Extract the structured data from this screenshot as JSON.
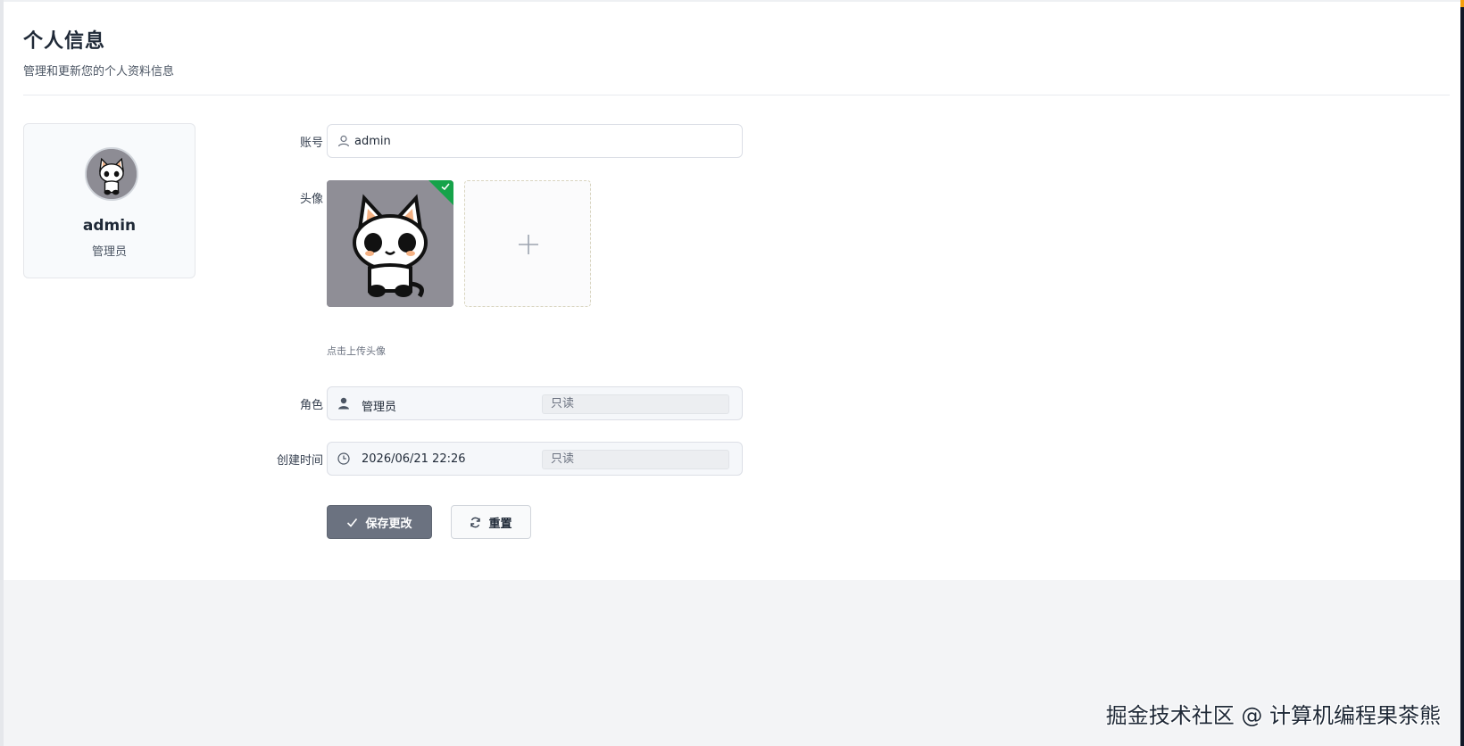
{
  "header": {
    "title": "个人信息",
    "subtitle": "管理和更新您的个人资料信息"
  },
  "profile": {
    "name": "admin",
    "role": "管理员"
  },
  "form": {
    "account": {
      "label": "账号",
      "value": "admin",
      "icon": "user-outline-icon"
    },
    "avatar": {
      "label": "头像",
      "upload_hint": "点击上传头像",
      "status": "uploaded"
    },
    "role": {
      "label": "角色",
      "value": "管理员",
      "readonly_tag": "只读",
      "icon": "user-solid-icon"
    },
    "created": {
      "label": "创建时间",
      "value": "2026/06/21 22:26",
      "readonly_tag": "只读",
      "icon": "clock-icon"
    }
  },
  "actions": {
    "save_label": "保存更改",
    "reset_label": "重置"
  },
  "watermark": "掘金技术社区 @ 计算机编程果茶熊",
  "colors": {
    "primary_button": "#6b7280",
    "success_badge": "#16a34a",
    "avatar_bg": "#8f8e96"
  }
}
